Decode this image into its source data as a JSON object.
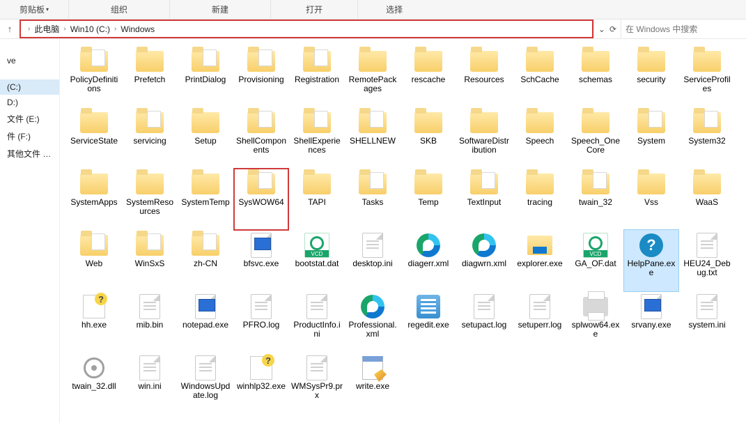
{
  "ribbon": {
    "groups": [
      "剪贴板",
      "组织",
      "新建",
      "打开",
      "选择"
    ]
  },
  "breadcrumb": {
    "items": [
      "此电脑",
      "Win10 (C:)",
      "Windows"
    ]
  },
  "search": {
    "placeholder": "在 Windows 中搜索"
  },
  "sidebar": {
    "items": [
      {
        "label": "",
        "sel": false
      },
      {
        "label": "ve",
        "sel": false
      },
      {
        "label": "",
        "sel": false
      },
      {
        "label": "",
        "sel": false
      },
      {
        "label": " (C:)",
        "sel": true
      },
      {
        "label": "D:)",
        "sel": false
      },
      {
        "label": "文件 (E:)",
        "sel": false
      },
      {
        "label": "件 (F:)",
        "sel": false
      },
      {
        "label": "其他文件 (G:)",
        "sel": false
      }
    ]
  },
  "items": [
    {
      "name": "PolicyDefinitions",
      "type": "folder-paper"
    },
    {
      "name": "Prefetch",
      "type": "folder"
    },
    {
      "name": "PrintDialog",
      "type": "folder-paper"
    },
    {
      "name": "Provisioning",
      "type": "folder-paper"
    },
    {
      "name": "Registration",
      "type": "folder-paper"
    },
    {
      "name": "RemotePackages",
      "type": "folder"
    },
    {
      "name": "rescache",
      "type": "folder"
    },
    {
      "name": "Resources",
      "type": "folder"
    },
    {
      "name": "SchCache",
      "type": "folder"
    },
    {
      "name": "schemas",
      "type": "folder"
    },
    {
      "name": "security",
      "type": "folder"
    },
    {
      "name": "ServiceProfiles",
      "type": "folder"
    },
    {
      "name": "ServiceState",
      "type": "folder"
    },
    {
      "name": "servicing",
      "type": "folder-paper"
    },
    {
      "name": "Setup",
      "type": "folder"
    },
    {
      "name": "ShellComponents",
      "type": "folder-paper"
    },
    {
      "name": "ShellExperiences",
      "type": "folder-paper"
    },
    {
      "name": "SHELLNEW",
      "type": "folder-paper"
    },
    {
      "name": "SKB",
      "type": "folder"
    },
    {
      "name": "SoftwareDistribution",
      "type": "folder"
    },
    {
      "name": "Speech",
      "type": "folder"
    },
    {
      "name": "Speech_OneCore",
      "type": "folder"
    },
    {
      "name": "System",
      "type": "folder-paper"
    },
    {
      "name": "System32",
      "type": "folder-paper"
    },
    {
      "name": "SystemApps",
      "type": "folder"
    },
    {
      "name": "SystemResources",
      "type": "folder"
    },
    {
      "name": "SystemTemp",
      "type": "folder"
    },
    {
      "name": "SysWOW64",
      "type": "folder-paper",
      "hl": true
    },
    {
      "name": "TAPI",
      "type": "folder"
    },
    {
      "name": "Tasks",
      "type": "folder-paper"
    },
    {
      "name": "Temp",
      "type": "folder"
    },
    {
      "name": "TextInput",
      "type": "folder-paper"
    },
    {
      "name": "tracing",
      "type": "folder"
    },
    {
      "name": "twain_32",
      "type": "folder-paper"
    },
    {
      "name": "Vss",
      "type": "folder"
    },
    {
      "name": "WaaS",
      "type": "folder"
    },
    {
      "name": "Web",
      "type": "folder-paper"
    },
    {
      "name": "WinSxS",
      "type": "folder-paper"
    },
    {
      "name": "zh-CN",
      "type": "folder-paper"
    },
    {
      "name": "bfsvc.exe",
      "type": "exe-blue"
    },
    {
      "name": "bootstat.dat",
      "type": "vcd"
    },
    {
      "name": "desktop.ini",
      "type": "file"
    },
    {
      "name": "diagerr.xml",
      "type": "edge"
    },
    {
      "name": "diagwrn.xml",
      "type": "edge"
    },
    {
      "name": "explorer.exe",
      "type": "explorer"
    },
    {
      "name": "GA_OF.dat",
      "type": "vcd"
    },
    {
      "name": "HelpPane.exe",
      "type": "help",
      "sel": true
    },
    {
      "name": "HEU24_Debug.txt",
      "type": "file"
    },
    {
      "name": "hh.exe",
      "type": "hh"
    },
    {
      "name": "mib.bin",
      "type": "file"
    },
    {
      "name": "notepad.exe",
      "type": "exe-blue"
    },
    {
      "name": "PFRO.log",
      "type": "file"
    },
    {
      "name": "ProductInfo.ini",
      "type": "file"
    },
    {
      "name": "Professional.xml",
      "type": "edge"
    },
    {
      "name": "regedit.exe",
      "type": "regedit"
    },
    {
      "name": "setupact.log",
      "type": "file"
    },
    {
      "name": "setuperr.log",
      "type": "file"
    },
    {
      "name": "splwow64.exe",
      "type": "printer"
    },
    {
      "name": "srvany.exe",
      "type": "exe-blue"
    },
    {
      "name": "system.ini",
      "type": "file"
    },
    {
      "name": "twain_32.dll",
      "type": "gear"
    },
    {
      "name": "win.ini",
      "type": "file"
    },
    {
      "name": "WindowsUpdate.log",
      "type": "file"
    },
    {
      "name": "winhlp32.exe",
      "type": "hh"
    },
    {
      "name": "WMSysPr9.prx",
      "type": "file"
    },
    {
      "name": "write.exe",
      "type": "writepad"
    }
  ]
}
